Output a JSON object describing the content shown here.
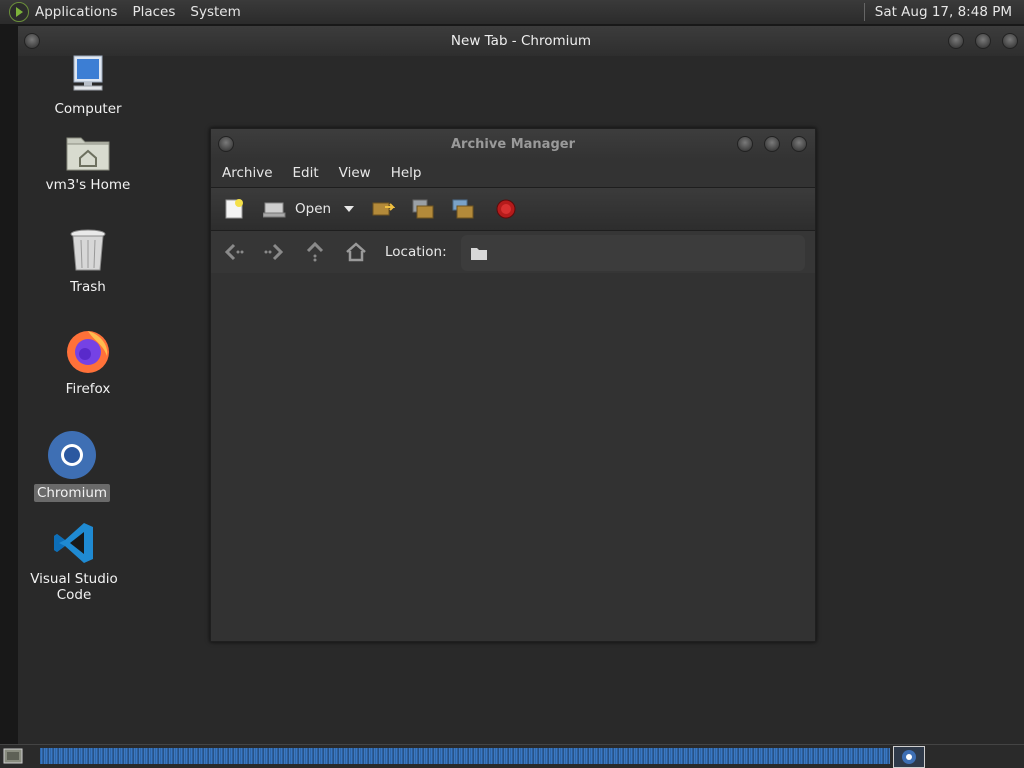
{
  "top_panel": {
    "menus": [
      "Applications",
      "Places",
      "System"
    ],
    "clock": "Sat Aug 17,  8:48 PM"
  },
  "chromium_window": {
    "title": "New Tab - Chromium"
  },
  "desktop_icons": [
    {
      "label": "Computer",
      "icon": "computer-icon"
    },
    {
      "label": "vm3's Home",
      "icon": "home-folder-icon"
    },
    {
      "label": "Trash",
      "icon": "trash-icon"
    },
    {
      "label": "Firefox",
      "icon": "firefox-icon"
    },
    {
      "label": "Chromium",
      "icon": "chromium-icon",
      "selected": true
    },
    {
      "label": "Visual Studio Code",
      "icon": "vscode-icon"
    }
  ],
  "archive_manager": {
    "title": "Archive Manager",
    "menu": [
      "Archive",
      "Edit",
      "View",
      "Help"
    ],
    "toolbar": {
      "open_label": "Open"
    },
    "location": {
      "label": "Location:",
      "value": ""
    }
  },
  "colors": {
    "accent": "#3c7fd0",
    "selection": "#6a6a6a"
  }
}
